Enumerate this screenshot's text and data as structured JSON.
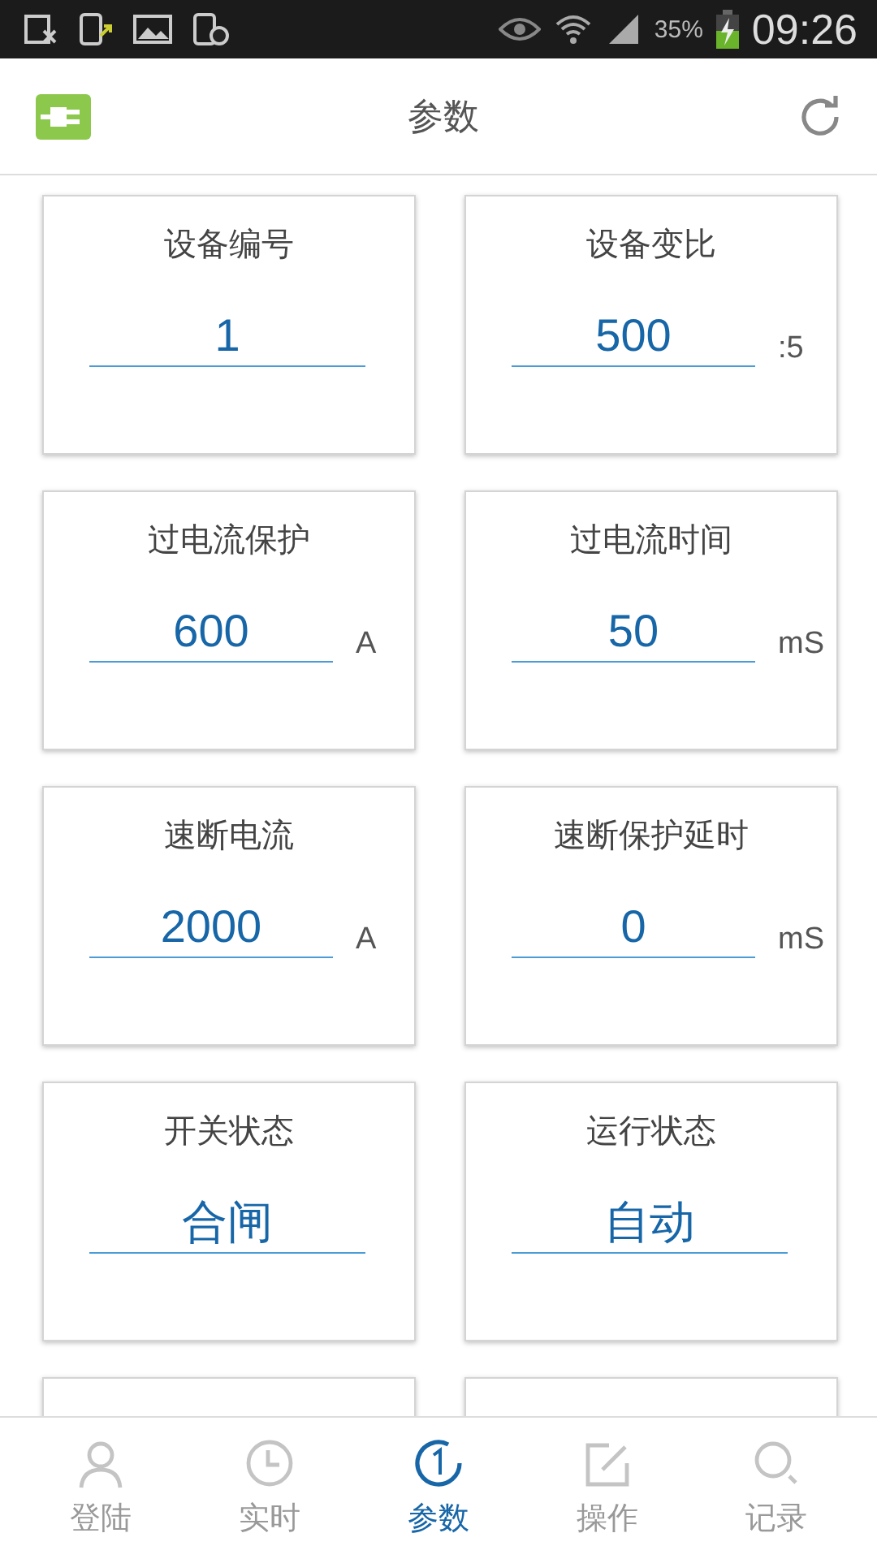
{
  "status_bar": {
    "battery_text": "35%",
    "time": "09:26"
  },
  "header": {
    "title": "参数"
  },
  "params": [
    {
      "label": "设备编号",
      "value": "1"
    },
    {
      "label": "设备变比",
      "value": "500",
      "unit": ":5"
    },
    {
      "label": "过电流保护",
      "value": "600",
      "unit": "A"
    },
    {
      "label": "过电流时间",
      "value": "50",
      "unit": "mS"
    },
    {
      "label": "速断电流",
      "value": "2000",
      "unit": "A"
    },
    {
      "label": "速断保护延时",
      "value": "0",
      "unit": "mS"
    },
    {
      "label": "开关状态",
      "value": "合闸"
    },
    {
      "label": "运行状态",
      "value": "自动"
    }
  ],
  "cut_cards": [
    {
      "kind": "empty"
    },
    {
      "kind": "empty"
    }
  ],
  "tabs": [
    {
      "label": "登陆",
      "kind": "user",
      "selected": false
    },
    {
      "label": "实时",
      "kind": "clock",
      "selected": false
    },
    {
      "label": "参数",
      "kind": "param",
      "selected": true
    },
    {
      "label": "操作",
      "kind": "edit",
      "selected": false
    },
    {
      "label": "记录",
      "kind": "search",
      "selected": false
    }
  ]
}
